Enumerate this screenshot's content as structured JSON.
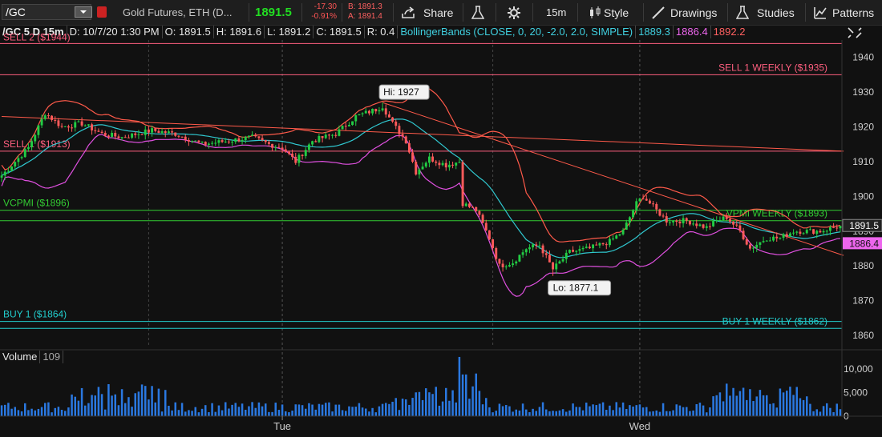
{
  "toolbar": {
    "symbol": "/GC",
    "description": "Gold Futures, ETH (D...",
    "last": "1891.5",
    "change": "-17.30",
    "change_pct": "-0.91%",
    "bid": "B: 1891.3",
    "ask": "A: 1891.4",
    "share": "Share",
    "timeframe": "15m",
    "style": "Style",
    "drawings": "Drawings",
    "studies": "Studies",
    "patterns": "Patterns",
    "colors": {
      "last": "#22dd22",
      "change": "#ff5555"
    }
  },
  "info_bar": {
    "chart_id": "/GC 5 D 15m",
    "date": "D: 10/7/20 1:30 PM",
    "open": "O: 1891.5",
    "high": "H: 1891.6",
    "low": "L: 1891.2",
    "close": "C: 1891.5",
    "range": "R: 0.4",
    "study": "BollingerBands (CLOSE, 0, 20, -2.0, 2.0, SIMPLE)",
    "study_mid": "1889.3",
    "study_lower": "1886.4",
    "study_upper": "1892.2"
  },
  "volume_panel": {
    "label": "Volume",
    "value": "109"
  },
  "chart_data": {
    "type": "candlestick",
    "ylim": [
      1857,
      1945
    ],
    "y_ticks": [
      1860,
      1870,
      1880,
      1890,
      1900,
      1910,
      1920,
      1930,
      1940
    ],
    "x_labels": [
      {
        "label": "Tue",
        "x": 84
      },
      {
        "label": "Wed",
        "x": 191
      }
    ],
    "bar_count": 252,
    "last_price": {
      "label": "1891.5",
      "value": 1891.5,
      "color": "#ffffff"
    },
    "lower_band_price": {
      "label": "1886.4",
      "value": 1886.4,
      "color": "#ee66ee"
    },
    "horizontal_levels": [
      {
        "label": "SELL 1 WEEKLY ($1935)",
        "value": 1935,
        "color": "#ff5f7f"
      },
      {
        "label": "SELL 1 ($1913)",
        "value": 1913,
        "color": "#ff5f7f"
      },
      {
        "label": "VCPMI ($1896)",
        "value": 1896,
        "color": "#33cc33"
      },
      {
        "label": "VPMI WEEKLY ($1893)",
        "value": 1893,
        "color": "#33cc33"
      },
      {
        "label": "BUY 1 ($1864)",
        "value": 1864,
        "color": "#22cccc"
      },
      {
        "label": "BUY 1 WEEKLY ($1862)",
        "value": 1862,
        "color": "#22cccc"
      },
      {
        "label": "SELL 2 ($1944)",
        "value": 1944,
        "color": "#ff5f7f"
      }
    ],
    "annotations": [
      {
        "text": "Hi: 1927",
        "x": 114,
        "y": 1927
      },
      {
        "text": "Lo: 1877.1",
        "x": 165,
        "y": 1877.1
      }
    ],
    "trend_lines": [
      {
        "x1": 0,
        "y1": 1923,
        "x2": 252,
        "y2": 1913
      },
      {
        "x1": 114,
        "y1": 1927,
        "x2": 252,
        "y2": 1883
      }
    ],
    "bollinger": {
      "period": 20,
      "stddev": 2.0
    },
    "volume": {
      "ylim": [
        0,
        13000
      ],
      "y_ticks": [
        {
          "label": "10,000",
          "value": 10000
        },
        {
          "label": "5,000",
          "value": 5000
        },
        {
          "label": "0",
          "value": 0
        }
      ]
    },
    "price_anchors": [
      [
        0,
        1906
      ],
      [
        8,
        1914
      ],
      [
        13,
        1924
      ],
      [
        18,
        1920
      ],
      [
        24,
        1921
      ],
      [
        30,
        1918
      ],
      [
        36,
        1917
      ],
      [
        45,
        1919
      ],
      [
        52,
        1918
      ],
      [
        60,
        1915
      ],
      [
        68,
        1916
      ],
      [
        75,
        1917
      ],
      [
        80,
        1915
      ],
      [
        84,
        1914
      ],
      [
        88,
        1910
      ],
      [
        93,
        1916
      ],
      [
        100,
        1918
      ],
      [
        106,
        1923
      ],
      [
        112,
        1925
      ],
      [
        114,
        1926
      ],
      [
        117,
        1921
      ],
      [
        121,
        1916
      ],
      [
        124,
        1907
      ],
      [
        128,
        1911
      ],
      [
        133,
        1909
      ],
      [
        137,
        1910
      ],
      [
        138,
        1898
      ],
      [
        142,
        1896
      ],
      [
        146,
        1888
      ],
      [
        149,
        1880
      ],
      [
        153,
        1881
      ],
      [
        157,
        1885
      ],
      [
        161,
        1886
      ],
      [
        165,
        1879
      ],
      [
        170,
        1884
      ],
      [
        176,
        1885
      ],
      [
        182,
        1887
      ],
      [
        186,
        1890
      ],
      [
        190,
        1898
      ],
      [
        192,
        1900
      ],
      [
        195,
        1897
      ],
      [
        199,
        1893
      ],
      [
        205,
        1893
      ],
      [
        211,
        1891
      ],
      [
        214,
        1893
      ],
      [
        217,
        1894
      ],
      [
        221,
        1890
      ],
      [
        224,
        1885
      ],
      [
        229,
        1888
      ],
      [
        233,
        1888
      ],
      [
        237,
        1890
      ],
      [
        241,
        1890
      ],
      [
        245,
        1890
      ],
      [
        251,
        1891.5
      ]
    ]
  }
}
